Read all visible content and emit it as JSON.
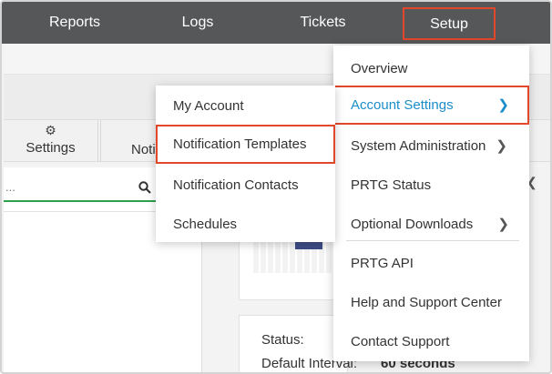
{
  "nav": {
    "items": [
      "Reports",
      "Logs",
      "Tickets",
      "Setup"
    ],
    "highlight_color": "#e2462b"
  },
  "page": {
    "tab_settings": "Settings",
    "tab_notifications": "Noti",
    "search_placeholder": "...",
    "status_label": "Status:",
    "interval_label": "Default Interval:",
    "interval_value": "60 seconds"
  },
  "setup_menu": {
    "items": [
      {
        "label": "Overview",
        "submenu": false
      },
      {
        "label": "Account Settings",
        "submenu": true,
        "active": true
      },
      {
        "label": "System Administration",
        "submenu": true
      },
      {
        "label": "PRTG Status",
        "submenu": false
      },
      {
        "label": "Optional Downloads",
        "submenu": true
      },
      {
        "label": "PRTG API",
        "submenu": false
      },
      {
        "label": "Help and Support Center",
        "submenu": false
      },
      {
        "label": "Contact Support",
        "submenu": false
      }
    ],
    "chevron": "chevron-right-icon",
    "active_color": "#1a8ec8"
  },
  "account_menu": {
    "items": [
      {
        "label": "My Account"
      },
      {
        "label": "Notification Templates",
        "active": true
      },
      {
        "label": "Notification Contacts"
      },
      {
        "label": "Schedules"
      }
    ]
  },
  "icons": {
    "gear": "gear-icon",
    "search": "search-icon",
    "collapse": "chevron-left-icon"
  }
}
